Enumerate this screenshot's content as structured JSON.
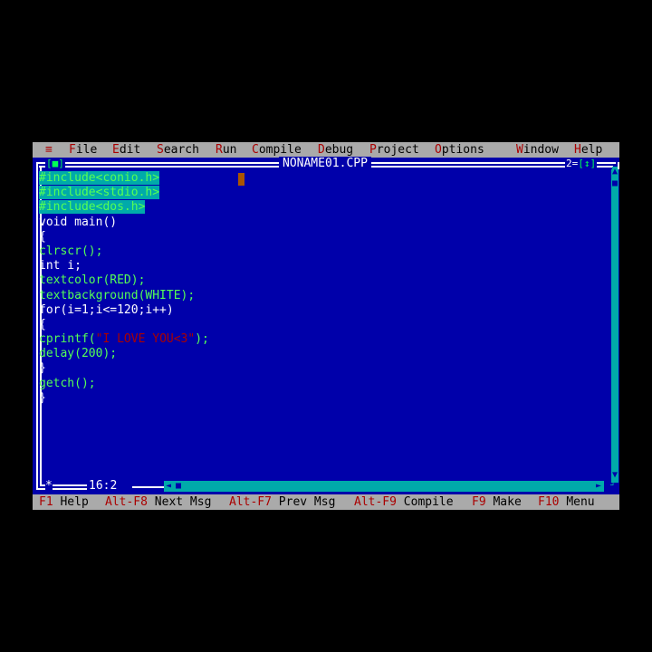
{
  "menu": {
    "system": "≡",
    "items": [
      {
        "hot": "F",
        "rest": "ile"
      },
      {
        "hot": "E",
        "rest": "dit"
      },
      {
        "hot": "S",
        "rest": "earch"
      },
      {
        "hot": "R",
        "rest": "un"
      },
      {
        "hot": "C",
        "rest": "ompile"
      },
      {
        "hot": "D",
        "rest": "ebug"
      },
      {
        "hot": "P",
        "rest": "roject"
      },
      {
        "hot": "O",
        "rest": "ptions"
      },
      {
        "hot": "W",
        "rest": "indow"
      },
      {
        "hot": "H",
        "rest": "elp"
      }
    ]
  },
  "window": {
    "title": "NONAME01.CPP",
    "close_button": "[■]",
    "number": "2",
    "zoom_button": "[↕]",
    "position": "16:2",
    "modified_marker": "*"
  },
  "code": {
    "lines": [
      "#include<conio.h>",
      "#include<stdio.h>",
      "#include<dos.h>",
      "void main()",
      "{",
      "clrscr();",
      "int i;",
      "textcolor(RED);",
      "textbackground(WHITE);",
      "for(i=1;i<=120;i++)",
      "{",
      "cprintf(\"I LOVE YOU<3\");",
      "delay(200);",
      "}",
      "getch();",
      "}"
    ]
  },
  "status": {
    "items": [
      {
        "key": "F1",
        "label": "Help"
      },
      {
        "key": "Alt-F8",
        "label": "Next Msg"
      },
      {
        "key": "Alt-F7",
        "label": "Prev Msg"
      },
      {
        "key": "Alt-F9",
        "label": "Compile"
      },
      {
        "key": "F9",
        "label": "Make"
      },
      {
        "key": "F10",
        "label": "Menu"
      }
    ]
  },
  "colors": {
    "editor_bg": "#0000aa",
    "menu_bg": "#aaaaaa",
    "hotkey": "#aa0000",
    "selection": "#00aaaa",
    "identifier": "#55ff55"
  }
}
